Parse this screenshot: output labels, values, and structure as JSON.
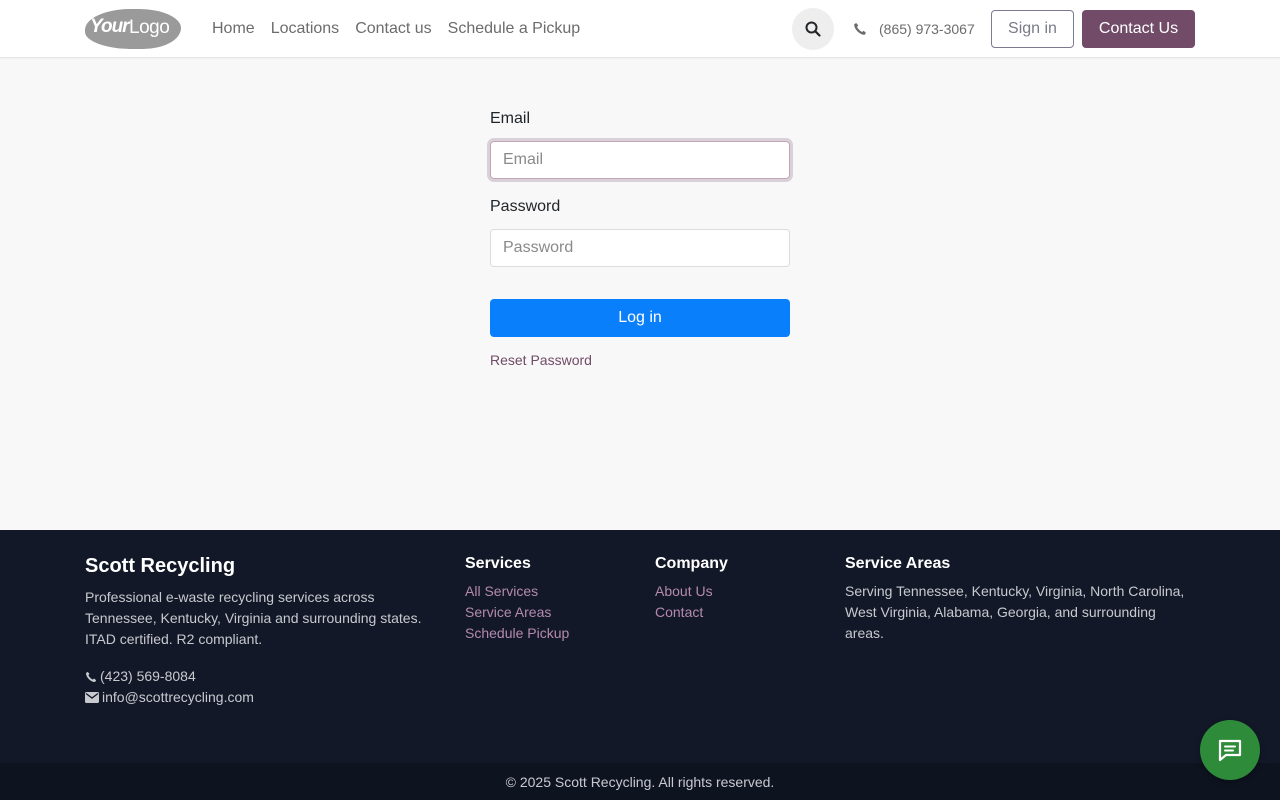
{
  "header": {
    "logo_text_1": "Your",
    "logo_text_2": "Logo",
    "nav": [
      "Home",
      "Locations",
      "Contact us",
      "Schedule a Pickup"
    ],
    "phone": "(865) 973-3067",
    "signin_label": "Sign in",
    "contact_label": "Contact Us",
    "icons": [
      "search-icon",
      "phone-icon"
    ],
    "brand_color": "#714b67"
  },
  "login": {
    "email_label": "Email",
    "email_placeholder": "Email",
    "email_value": "",
    "password_label": "Password",
    "password_placeholder": "Password",
    "password_value": "",
    "login_label": "Log in",
    "reset_label": "Reset Password",
    "primary_color": "#0a7ffc"
  },
  "footer": {
    "brand": "Scott Recycling",
    "description": "Professional e-waste recycling services across Tennessee, Kentucky, Virginia and surrounding states. ITAD certified. R2 compliant.",
    "phone": "(423) 569-8084",
    "email": "info@scottrecycling.com",
    "services_heading": "Services",
    "services_links": [
      "All Services",
      "Service Areas",
      "Schedule Pickup"
    ],
    "company_heading": "Company",
    "company_links": [
      "About Us",
      "Contact"
    ],
    "areas_heading": "Service Areas",
    "areas_text": "Serving Tennessee, Kentucky, Virginia, North Carolina, West Virginia, Alabama, Georgia, and surrounding areas.",
    "copyright": "© 2025 Scott Recycling. All rights reserved.",
    "background_color": "#121827"
  },
  "chat": {
    "icon": "chat-icon",
    "color": "#2e8b3a"
  }
}
